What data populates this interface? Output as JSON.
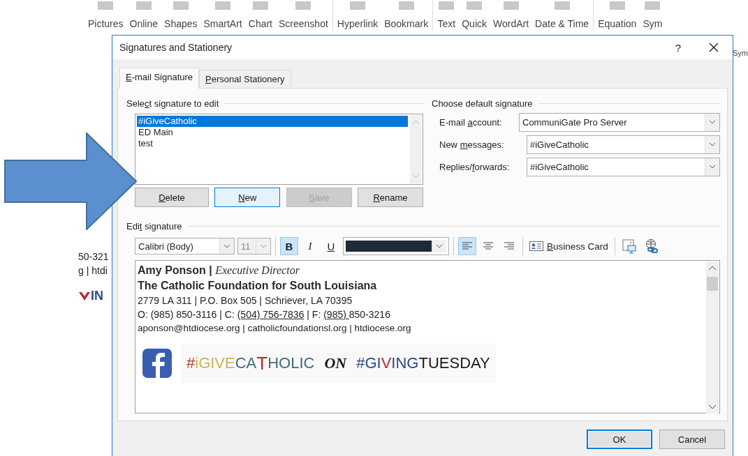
{
  "ribbon": {
    "groups": [
      [
        "Pictures",
        "Online",
        "Shapes",
        "SmartArt",
        "Chart",
        "Screenshot"
      ],
      [
        "Hyperlink",
        "Bookmark"
      ],
      [
        "Text",
        "Quick",
        "WordArt",
        "Date & Time"
      ],
      [
        "Equation",
        "Sym"
      ]
    ],
    "side_label": "Sym"
  },
  "document": {
    "lines": [
      "50-321",
      "g | htdi"
    ],
    "logo_text": "IN"
  },
  "dialog": {
    "title": "Signatures and Stationery",
    "help": "?",
    "tabs": [
      {
        "key": "E",
        "rest": "-mail Signature",
        "selected": true
      },
      {
        "key": "P",
        "rest": "ersonal Stationery",
        "selected": false
      }
    ],
    "select_section": {
      "lead": "Sele",
      "key": "c",
      "rest": "t signature to edit"
    },
    "signatures": [
      {
        "name": "#iGiveCatholic",
        "selected": true
      },
      {
        "name": "ED Main",
        "selected": false
      },
      {
        "name": "test",
        "selected": false
      }
    ],
    "list_buttons": [
      {
        "key": "D",
        "rest": "elete",
        "focused": false,
        "disabled": false
      },
      {
        "key": "N",
        "rest": "ew",
        "focused": true,
        "disabled": false
      },
      {
        "key": "S",
        "rest": "ave",
        "focused": false,
        "disabled": true
      },
      {
        "key": "R",
        "rest": "ename",
        "focused": false,
        "disabled": false
      }
    ],
    "default_section": {
      "lead": "Choose default signature"
    },
    "defaults": [
      {
        "lead": "E-mail ",
        "key": "a",
        "rest": "ccount:",
        "value": "CommuniGate Pro Server",
        "wide": true
      },
      {
        "lead": "New ",
        "key": "m",
        "rest": "essages:",
        "value": "#iGiveCatholic",
        "wide": false
      },
      {
        "lead": "Replies/",
        "key": "f",
        "rest": "orwards:",
        "value": "#iGiveCatholic",
        "wide": false
      }
    ],
    "edit_section": {
      "lead": "Edi",
      "key": "t",
      "rest": " signature"
    },
    "toolbar": {
      "font": "Calibri (Body)",
      "size": "11",
      "size_disabled": true,
      "bold": {
        "label": "B",
        "selected": true
      },
      "italic": {
        "label": "I",
        "selected": false
      },
      "underline": {
        "label": "U",
        "selected": false
      },
      "align": [
        {
          "kind": "left",
          "selected": true
        },
        {
          "kind": "center",
          "selected": false
        },
        {
          "kind": "right",
          "selected": false
        }
      ],
      "business_card": {
        "key": "B",
        "rest": "usiness Card"
      }
    },
    "signature_lines": [
      [
        {
          "text": "**Amy Ponson |** *Executive Director*",
          "underline": false
        }
      ],
      [
        {
          "text": "**The Catholic Foundation for South Louisiana**",
          "underline": false
        }
      ],
      [
        {
          "text": "2779 LA 311 | P.O. Box 505  | Schriever, LA 70395",
          "underline": false
        }
      ],
      [
        {
          "text": "O: (985) 850-3116 | C: ",
          "underline": false
        },
        {
          "text": "(504) 756-7836",
          "underline": true
        },
        {
          "text": " | F: ",
          "underline": false
        },
        {
          "text": "(985) ",
          "underline": true
        },
        {
          "text": "850-3216",
          "underline": false
        }
      ],
      [
        {
          "text": "aponson@htdiocese.org  | catholicfoundationsl.org | htdiocese.org",
          "underline": false
        }
      ]
    ],
    "banner": [
      {
        "text": "#",
        "color": "#c0392b",
        "kind": "plain"
      },
      {
        "text": "iGIVE",
        "color": "#c9b458",
        "kind": "plain"
      },
      {
        "text": "CA",
        "color": "#3f6a7f",
        "kind": "plain"
      },
      {
        "text": "T",
        "color": "#c0262d",
        "kind": "cross"
      },
      {
        "text": "HOLIC",
        "color": "#3f6a7f",
        "kind": "plain"
      },
      {
        "text": "ON",
        "color": "#1a1a1a",
        "kind": "serif"
      },
      {
        "text": "#GI",
        "color": "#2c4a8a",
        "kind": "plain"
      },
      {
        "text": "V",
        "color": "#c0262d",
        "kind": "heart"
      },
      {
        "text": "ING",
        "color": "#2c4a8a",
        "kind": "plain"
      },
      {
        "text": "TUESDAY",
        "color": "#1a1a1a",
        "kind": "plain"
      }
    ],
    "buttons": [
      {
        "label": "OK",
        "default": true
      },
      {
        "label": "Cancel",
        "default": false
      }
    ]
  }
}
